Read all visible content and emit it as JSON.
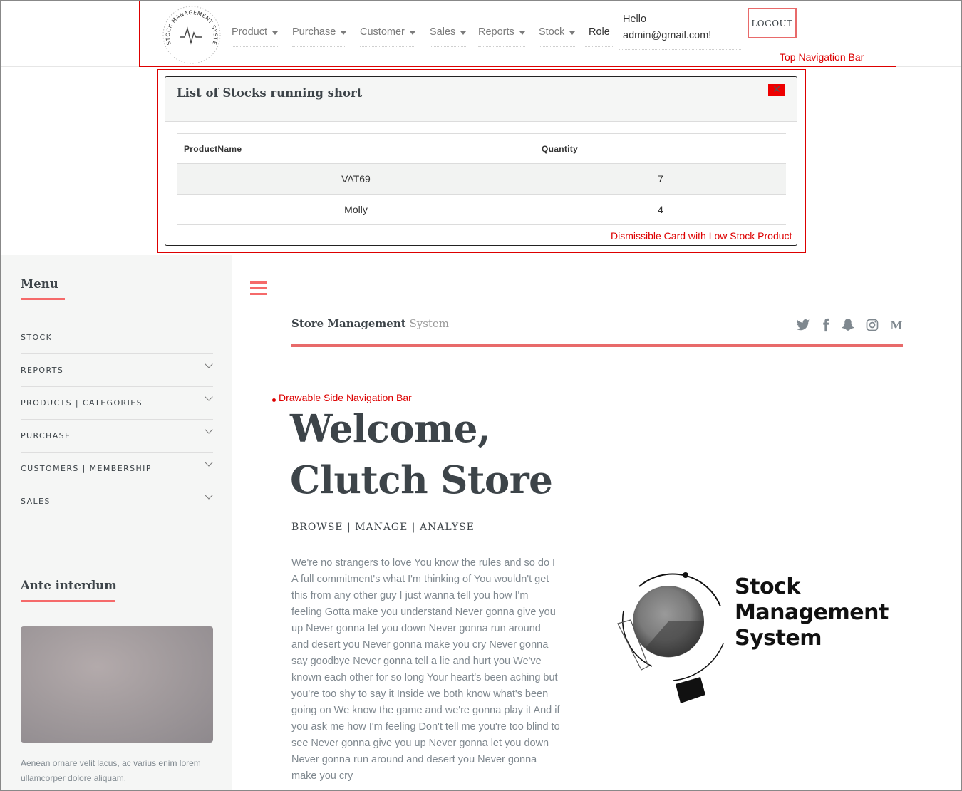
{
  "topnav": {
    "logo_ring_text": "STOCK MANAGEMENT SYSTEM",
    "menus": [
      "Product",
      "Purchase",
      "Customer",
      "Sales",
      "Reports",
      "Stock"
    ],
    "role": "Role",
    "hello_line1": "Hello",
    "hello_line2": "admin@gmail.com!",
    "logout": "LOGOUT"
  },
  "annotations": {
    "topnav": "Top Navigation Bar",
    "card": "Dismissible Card with Low Stock Product",
    "sidebar": "Drawable Side Navigation Bar"
  },
  "low_stock_card": {
    "title": "List of Stocks running short",
    "close_icon": "close-icon",
    "columns": [
      "ProductName",
      "Quantity"
    ],
    "rows": [
      {
        "product": "VAT69",
        "quantity": "7"
      },
      {
        "product": "Molly",
        "quantity": "4"
      }
    ]
  },
  "sidebar": {
    "menu_heading": "Menu",
    "items": [
      {
        "label": "STOCK",
        "expandable": false
      },
      {
        "label": "REPORTS",
        "expandable": true
      },
      {
        "label": "PRODUCTS | CATEGORIES",
        "expandable": true
      },
      {
        "label": "PURCHASE",
        "expandable": true
      },
      {
        "label": "CUSTOMERS | MEMBERSHIP",
        "expandable": true
      },
      {
        "label": "SALES",
        "expandable": true
      }
    ],
    "section2_heading": "Ante interdum",
    "section2_text": "Aenean ornare velit lacus, ac varius enim lorem ullamcorper dolore aliquam."
  },
  "main": {
    "brand_bold": "Store Management",
    "brand_light": " System",
    "social_icons": [
      "twitter-icon",
      "facebook-icon",
      "snapchat-icon",
      "instagram-icon",
      "medium-icon"
    ],
    "welcome_line1": "Welcome,",
    "welcome_line2": "Clutch Store",
    "tagline": "BROWSE | MANAGE | ANALYSE",
    "body": "We're no strangers to love You know the rules and so do I A full commitment's what I'm thinking of You wouldn't get this from any other guy I just wanna tell you how I'm feeling Gotta make you understand Never gonna give you up Never gonna let you down Never gonna run around and desert you Never gonna make you cry Never gonna say goodbye Never gonna tell a lie and hurt you We've known each other for so long Your heart's been aching but you're too shy to say it Inside we both know what's been going on We know the game and we're gonna play it And if you ask me how I'm feeling Don't tell me you're too blind to see Never gonna give you up Never gonna let you down Never gonna run around and desert you Never gonna make you cry",
    "logo_text": [
      "Stock",
      "Management",
      "System"
    ]
  },
  "colors": {
    "accent": "#f56a6a",
    "annotation": "#dd0000",
    "text": "#3d4449",
    "sidebar_bg": "#f5f6f5"
  }
}
